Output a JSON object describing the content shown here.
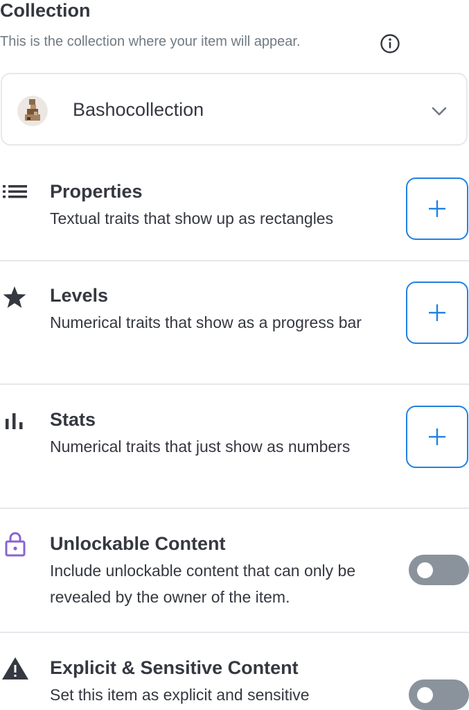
{
  "collection": {
    "title": "Collection",
    "subtitle": "This is the collection where your item will appear.",
    "selected": "Bashocollection"
  },
  "sections": {
    "properties": {
      "title": "Properties",
      "desc": "Textual traits that show up as rectangles"
    },
    "levels": {
      "title": "Levels",
      "desc": "Numerical traits that show as a progress bar"
    },
    "stats": {
      "title": "Stats",
      "desc": "Numerical traits that just show as numbers"
    },
    "unlockable": {
      "title": "Unlockable Content",
      "desc": "Include unlockable content that can only be revealed by the owner of the item.",
      "enabled": false
    },
    "explicit": {
      "title": "Explicit & Sensitive Content",
      "desc": "Set this item as explicit and sensitive",
      "enabled": false
    }
  },
  "icons": {
    "info": "info-icon",
    "chevron": "chevron-down-icon",
    "properties": "list-icon",
    "levels": "star-icon",
    "stats": "bar-chart-icon",
    "unlockable": "lock-icon",
    "explicit": "warning-icon",
    "add": "plus-icon"
  },
  "colors": {
    "accent": "#2081e2",
    "text": "#353840",
    "muted": "#707a83",
    "lock": "#8a63d2",
    "toggle_off": "#8a939b"
  }
}
